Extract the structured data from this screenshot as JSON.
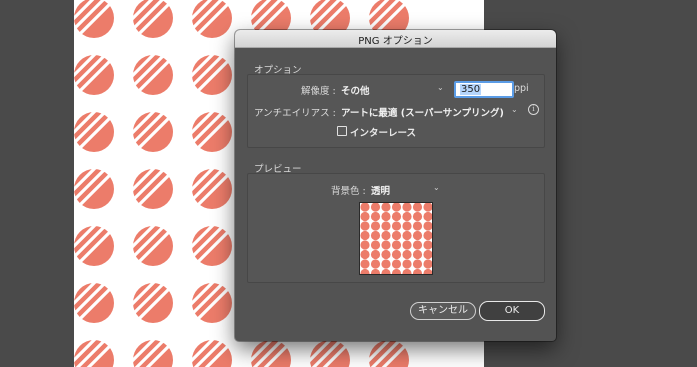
{
  "dialog": {
    "title": "PNG オプション",
    "options_section": "オプション",
    "resolution_label": "解像度 :",
    "resolution_value": "その他",
    "resolution_input": "350",
    "resolution_unit": "ppi",
    "antialias_label": "アンチエイリアス :",
    "antialias_value": "アートに最適 (スーパーサンプリング)",
    "interlace_label": "インターレース",
    "interlace_checked": false,
    "preview_section": "プレビュー",
    "bg_color_label": "背景色 :",
    "bg_color_value": "透明",
    "cancel_label": "キャンセル",
    "ok_label": "OK"
  },
  "icons": {
    "dropdown": "chevron-down-icon",
    "info": "info-icon",
    "checkbox": "checkbox-icon"
  },
  "colors": {
    "pattern": "#ec7c6a",
    "dialog_bg": "#535353",
    "focus_ring": "#5b9ce6"
  }
}
